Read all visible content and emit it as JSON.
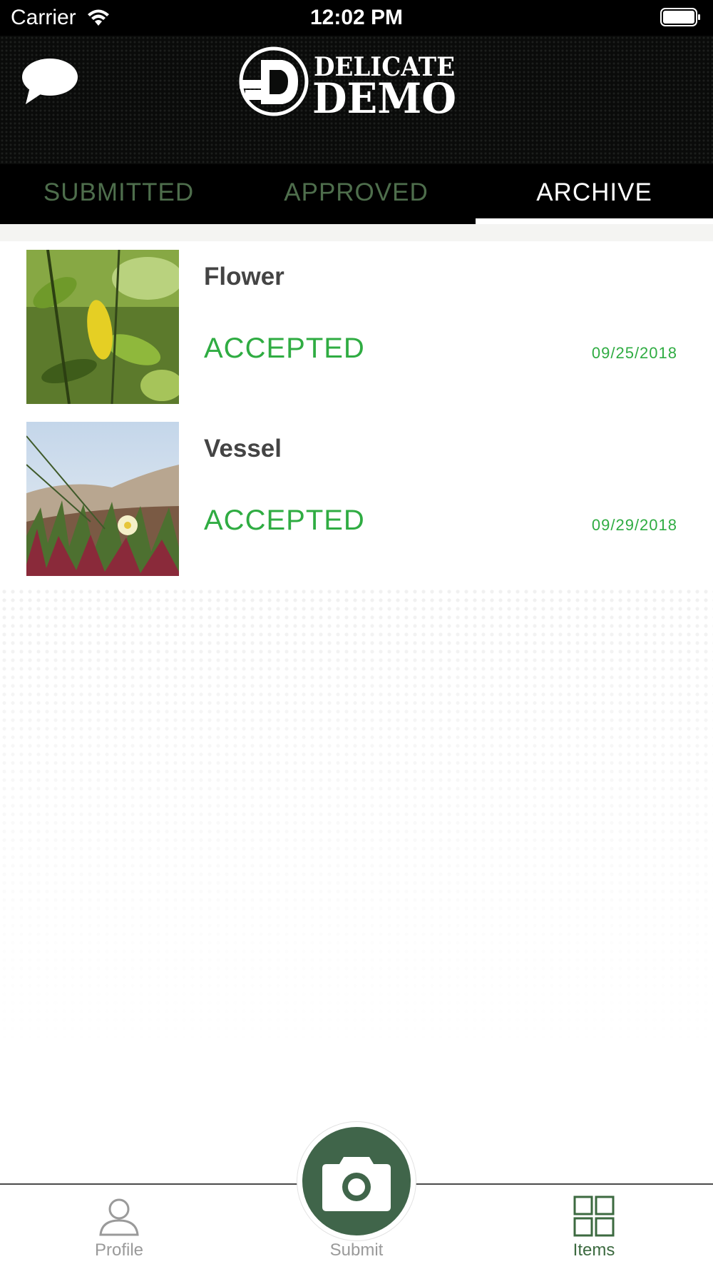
{
  "status_bar": {
    "carrier": "Carrier",
    "time": "12:02 PM"
  },
  "header": {
    "logo_line1": "DELICATE",
    "logo_line2": "DEMO",
    "chat_icon": "chat-bubble-icon"
  },
  "tabs": [
    {
      "label": "SUBMITTED",
      "active": false
    },
    {
      "label": "APPROVED",
      "active": false
    },
    {
      "label": "ARCHIVE",
      "active": true
    }
  ],
  "items": [
    {
      "title": "Flower",
      "status": "ACCEPTED",
      "date": "09/25/2018",
      "thumbnail": "leaves-photo"
    },
    {
      "title": "Vessel",
      "status": "ACCEPTED",
      "date": "09/29/2018",
      "thumbnail": "dune-flower-photo"
    }
  ],
  "tab_bar": {
    "items": [
      {
        "label": "Profile",
        "icon": "person-icon",
        "active": false
      },
      {
        "label": "Submit",
        "icon": "camera-icon",
        "active": false
      },
      {
        "label": "Items",
        "icon": "grid-icon",
        "active": true
      }
    ]
  },
  "colors": {
    "accent_green": "#2fac42",
    "brand_green": "#40654a",
    "inactive_tab": "#4e6e4c",
    "header_bg": "#0b0c0b"
  }
}
